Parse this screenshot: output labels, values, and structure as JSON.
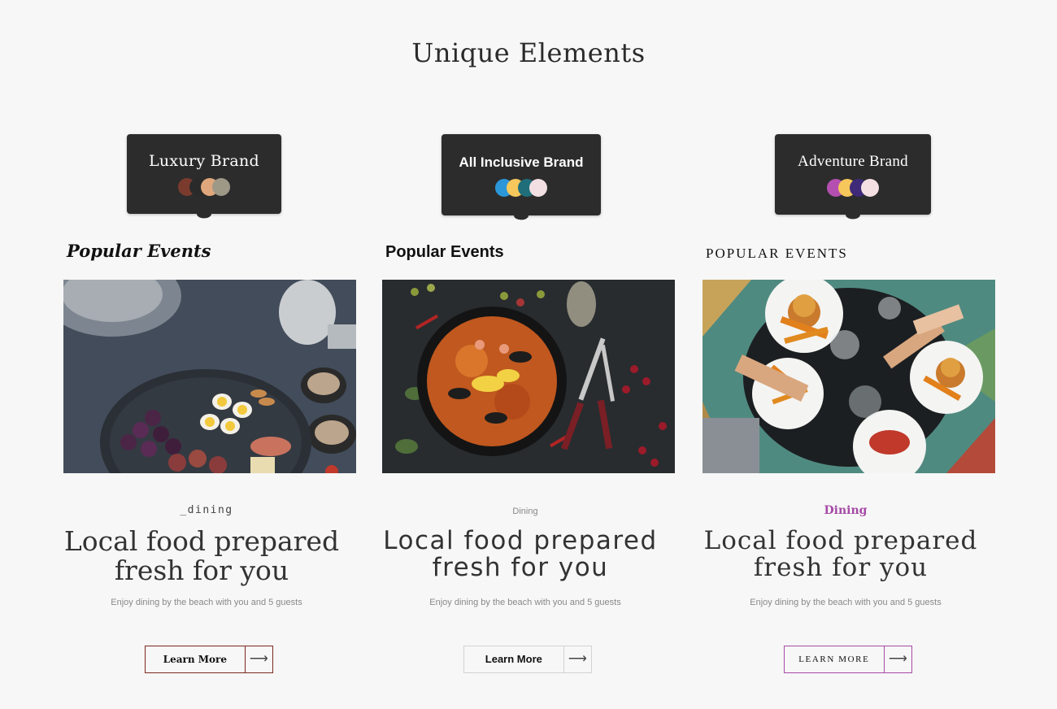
{
  "page": {
    "title": "Unique Elements"
  },
  "cards": [
    {
      "brand_label": "Luxury Brand",
      "swatches": [
        "#7a3b2e",
        "#2a2a2a",
        "#e0a77d",
        "#9e9887"
      ],
      "section_heading": "Popular Events",
      "category": "_dining",
      "headline_line1": "Local food prepared",
      "headline_line2": "fresh for you",
      "description": "Enjoy dining by the beach with you and 5 guests",
      "button_label": "Learn More",
      "button_icon": "arrow-right-icon",
      "accent": "#7a2a1e"
    },
    {
      "brand_label": "All Inclusive Brand",
      "swatches": [
        "#2b97d8",
        "#f6c75b",
        "#1f6e7a",
        "#f2dfe3"
      ],
      "section_heading": "Popular Events",
      "category": "Dining",
      "headline_line1": "Local food prepared",
      "headline_line2": "fresh for you",
      "description": "Enjoy dining by the beach with you and 5 guests",
      "button_label": "Learn More",
      "button_icon": "arrow-right-icon",
      "accent": "#d2d2d2"
    },
    {
      "brand_label": "Adventure Brand",
      "swatches": [
        "#b44fb0",
        "#f6c75b",
        "#3e2a78",
        "#f5e0e4"
      ],
      "section_heading": "POPULAR EVENTS",
      "category": "Dining",
      "headline_line1": "Local food prepared",
      "headline_line2": "fresh for you",
      "description": "Enjoy dining by the beach with you and 5 guests",
      "button_label": "LEARN MORE",
      "button_icon": "arrow-right-icon",
      "accent": "#a64aa6"
    }
  ]
}
